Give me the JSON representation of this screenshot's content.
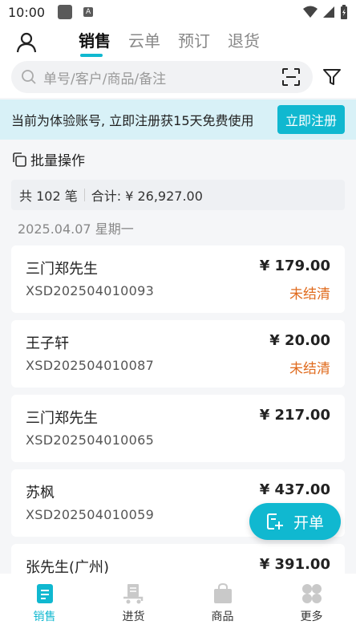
{
  "status_bar": {
    "time": "10:00"
  },
  "header": {
    "tabs": [
      {
        "label": "销售",
        "active": true
      },
      {
        "label": "云单",
        "active": false
      },
      {
        "label": "预订",
        "active": false
      },
      {
        "label": "退货",
        "active": false
      }
    ],
    "search": {
      "placeholder": "单号/客户/商品/备注"
    }
  },
  "banner": {
    "text": "当前为体验账号, 立即注册获15天免费使用",
    "button_label": "立即注册"
  },
  "batch": {
    "label": "批量操作"
  },
  "summary": {
    "count_text": "共 102 笔",
    "total_text": "合计: ¥ 26,927.00"
  },
  "date_header": "2025.04.07 星期一",
  "orders": [
    {
      "customer": "三门郑先生",
      "order_no": "XSD202504010093",
      "amount": "¥ 179.00",
      "status": "未结清"
    },
    {
      "customer": "王子轩",
      "order_no": "XSD202504010087",
      "amount": "¥ 20.00",
      "status": "未结清"
    },
    {
      "customer": "三门郑先生",
      "order_no": "XSD202504010065",
      "amount": "¥ 217.00",
      "status": ""
    },
    {
      "customer": "苏枫",
      "order_no": "XSD202504010059",
      "amount": "¥ 437.00",
      "status": ""
    },
    {
      "customer": "张先生(广州)",
      "order_no": "",
      "amount": "¥ 391.00",
      "status": ""
    }
  ],
  "fab": {
    "label": "开单"
  },
  "bottom_nav": [
    {
      "label": "销售",
      "icon": "sales-doc-icon",
      "active": true
    },
    {
      "label": "进货",
      "icon": "purchase-cart-icon",
      "active": false
    },
    {
      "label": "商品",
      "icon": "goods-bag-icon",
      "active": false
    },
    {
      "label": "更多",
      "icon": "more-grid-icon",
      "active": false
    }
  ],
  "colors": {
    "accent": "#10b8d0",
    "status_unpaid": "#e06b1e",
    "banner_bg": "#d8f1f7"
  }
}
